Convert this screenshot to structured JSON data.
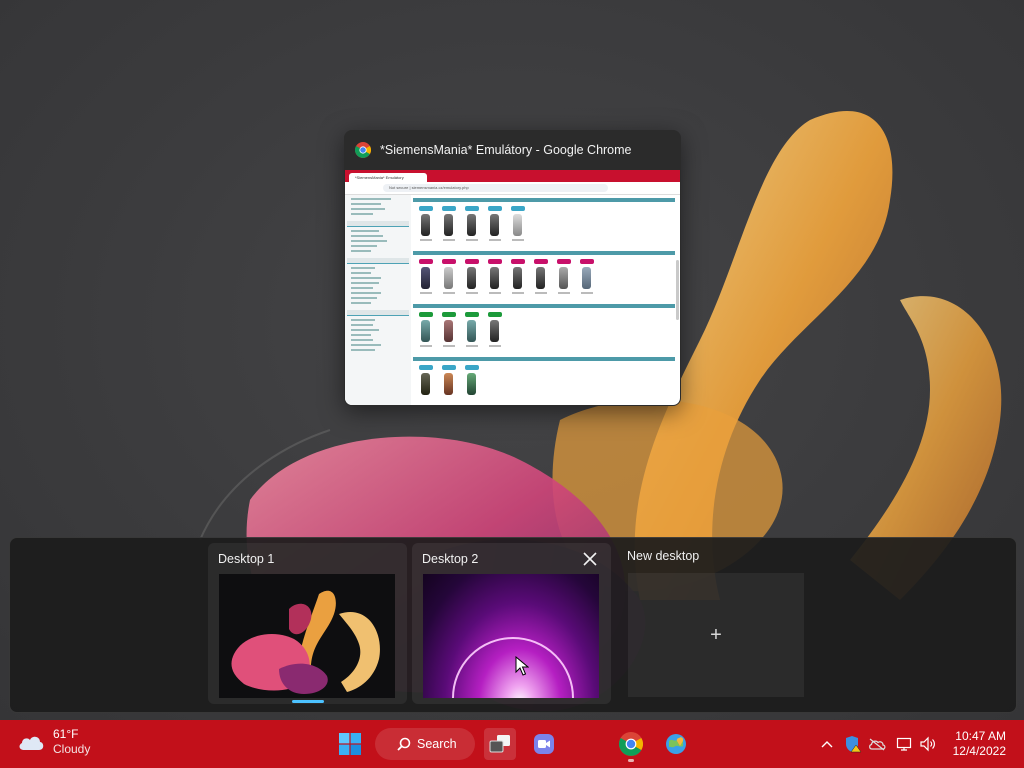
{
  "window": {
    "title": "*SiemensMania* Emulátory - Google Chrome",
    "tab_title": "*SiemensMania* Emulátory",
    "address": "Not secure | siemensmania.cz/emulatory.php"
  },
  "task_view": {
    "desktops": [
      {
        "label": "Desktop 1",
        "active": true
      },
      {
        "label": "Desktop 2",
        "active": false
      }
    ],
    "new_desktop_label": "New desktop",
    "plus_symbol": "+"
  },
  "taskbar": {
    "weather": {
      "temp": "61°F",
      "condition": "Cloudy"
    },
    "search_label": "Search",
    "clock": {
      "time": "10:47 AM",
      "date": "12/4/2022"
    },
    "accent_color": "#c2101a"
  },
  "icons": [
    "cloud-icon",
    "windows-start-icon",
    "search-icon",
    "task-view-icon",
    "chat-icon",
    "chrome-icon",
    "maps-icon",
    "chevron-up-icon",
    "defender-icon",
    "onedrive-icon",
    "network-icon",
    "volume-icon",
    "close-icon",
    "plus-icon"
  ]
}
